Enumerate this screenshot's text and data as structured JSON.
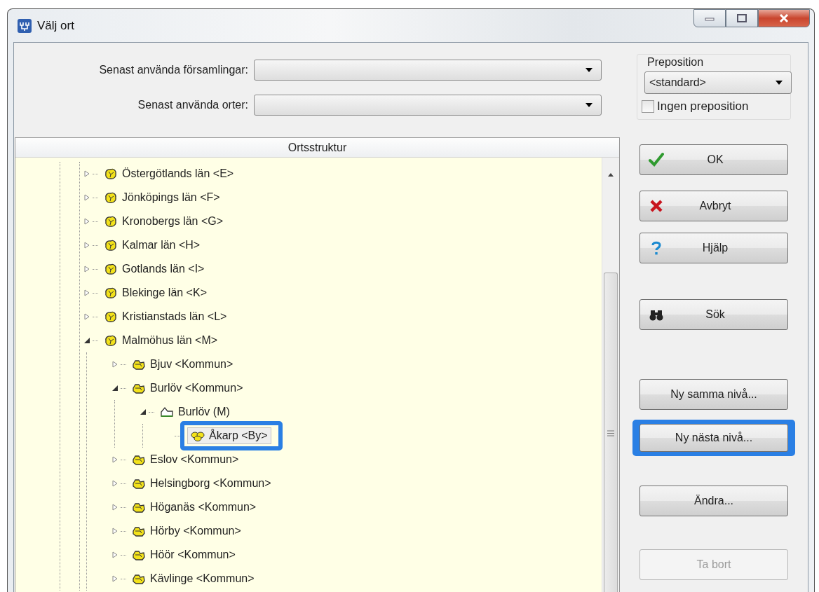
{
  "window": {
    "title": "Välj ort"
  },
  "recent": [
    {
      "label": "Senast använda församlingar:"
    },
    {
      "label": "Senast använda orter:"
    }
  ],
  "tree": {
    "header": "Ortsstruktur",
    "nodes": [
      {
        "label": "Östergötlands län <E>",
        "kind": "county",
        "expanded": false,
        "selected": false
      },
      {
        "label": "Jönköpings län <F>",
        "kind": "county",
        "expanded": false,
        "selected": false
      },
      {
        "label": "Kronobergs län <G>",
        "kind": "county",
        "expanded": false,
        "selected": false
      },
      {
        "label": "Kalmar län <H>",
        "kind": "county",
        "expanded": false,
        "selected": false
      },
      {
        "label": "Gotlands län <I>",
        "kind": "county",
        "expanded": false,
        "selected": false
      },
      {
        "label": "Blekinge län <K>",
        "kind": "county",
        "expanded": false,
        "selected": false
      },
      {
        "label": "Kristianstads län <L>",
        "kind": "county",
        "expanded": false,
        "selected": false
      },
      {
        "label": "Malmöhus län <M>",
        "kind": "county",
        "expanded": true,
        "selected": false,
        "children": [
          {
            "label": "Bjuv <Kommun>",
            "kind": "municipality",
            "expanded": false,
            "selected": false
          },
          {
            "label": "Burlöv <Kommun>",
            "kind": "municipality",
            "expanded": true,
            "selected": false,
            "children": [
              {
                "label": "Burlöv (M)",
                "kind": "parish",
                "expanded": true,
                "selected": false,
                "children": [
                  {
                    "label": "Åkarp <By>",
                    "kind": "village",
                    "selected": true,
                    "highlighted": true
                  }
                ]
              }
            ]
          },
          {
            "label": "Eslov <Kommun>",
            "kind": "municipality",
            "expanded": false,
            "selected": false
          },
          {
            "label": "Helsingborg <Kommun>",
            "kind": "municipality",
            "expanded": false,
            "selected": false
          },
          {
            "label": "Höganäs <Kommun>",
            "kind": "municipality",
            "expanded": false,
            "selected": false
          },
          {
            "label": "Hörby <Kommun>",
            "kind": "municipality",
            "expanded": false,
            "selected": false
          },
          {
            "label": "Höör <Kommun>",
            "kind": "municipality",
            "expanded": false,
            "selected": false
          },
          {
            "label": "Kävlinge <Kommun>",
            "kind": "municipality",
            "expanded": false,
            "selected": false
          }
        ]
      }
    ]
  },
  "preposition": {
    "label": "Preposition",
    "value": "<standard>",
    "no_preposition": {
      "label": "Ingen preposition",
      "checked": false
    }
  },
  "buttons": [
    {
      "label": "OK",
      "disabled": false,
      "highlighted": false
    },
    {
      "label": "Avbryt",
      "disabled": false,
      "highlighted": false
    },
    {
      "label": "Hjälp",
      "disabled": false,
      "highlighted": false
    },
    {
      "label": "Sök",
      "disabled": false,
      "highlighted": false
    },
    {
      "label": "Ny samma nivå...",
      "disabled": false,
      "highlighted": false
    },
    {
      "label": "Ny nästa nivå...",
      "disabled": false,
      "highlighted": true
    },
    {
      "label": "Ändra...",
      "disabled": false,
      "highlighted": false
    },
    {
      "label": "Ta bort",
      "disabled": true,
      "highlighted": false
    }
  ]
}
